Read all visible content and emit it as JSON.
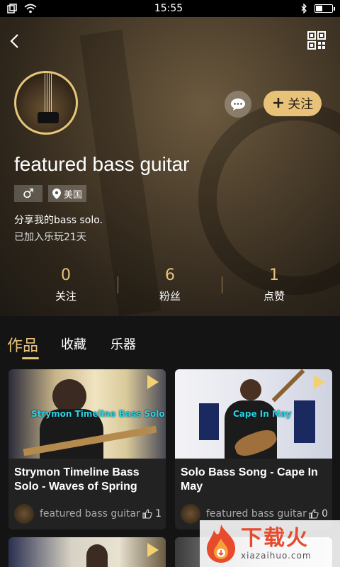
{
  "status_bar": {
    "time": "15:55"
  },
  "header": {
    "username": "featured bass guitar",
    "gender_symbol": "♂",
    "location": "美国",
    "bio": "分享我的bass solo.",
    "joined": "已加入乐玩21天",
    "follow_label": "关注",
    "follow_plus": "+",
    "accent_color": "#e9c27a"
  },
  "stats": [
    {
      "value": "0",
      "label": "关注"
    },
    {
      "value": "6",
      "label": "粉丝"
    },
    {
      "value": "1",
      "label": "点赞"
    }
  ],
  "tabs": [
    {
      "label": "作品",
      "active": true
    },
    {
      "label": "收藏",
      "active": false
    },
    {
      "label": "乐器",
      "active": false
    }
  ],
  "cards": [
    {
      "overlay_text": "Strymon Timeline Bass Solo",
      "title": "Strymon Timeline Bass Solo - Waves of Spring",
      "author": "featured bass guitar",
      "likes": "1"
    },
    {
      "overlay_text": "Cape In May",
      "title": "Solo Bass Song - Cape In May",
      "author": "featured bass guitar",
      "likes": "0"
    }
  ],
  "watermark": {
    "cn": "下载火",
    "en": "xiazaihuo.com"
  }
}
